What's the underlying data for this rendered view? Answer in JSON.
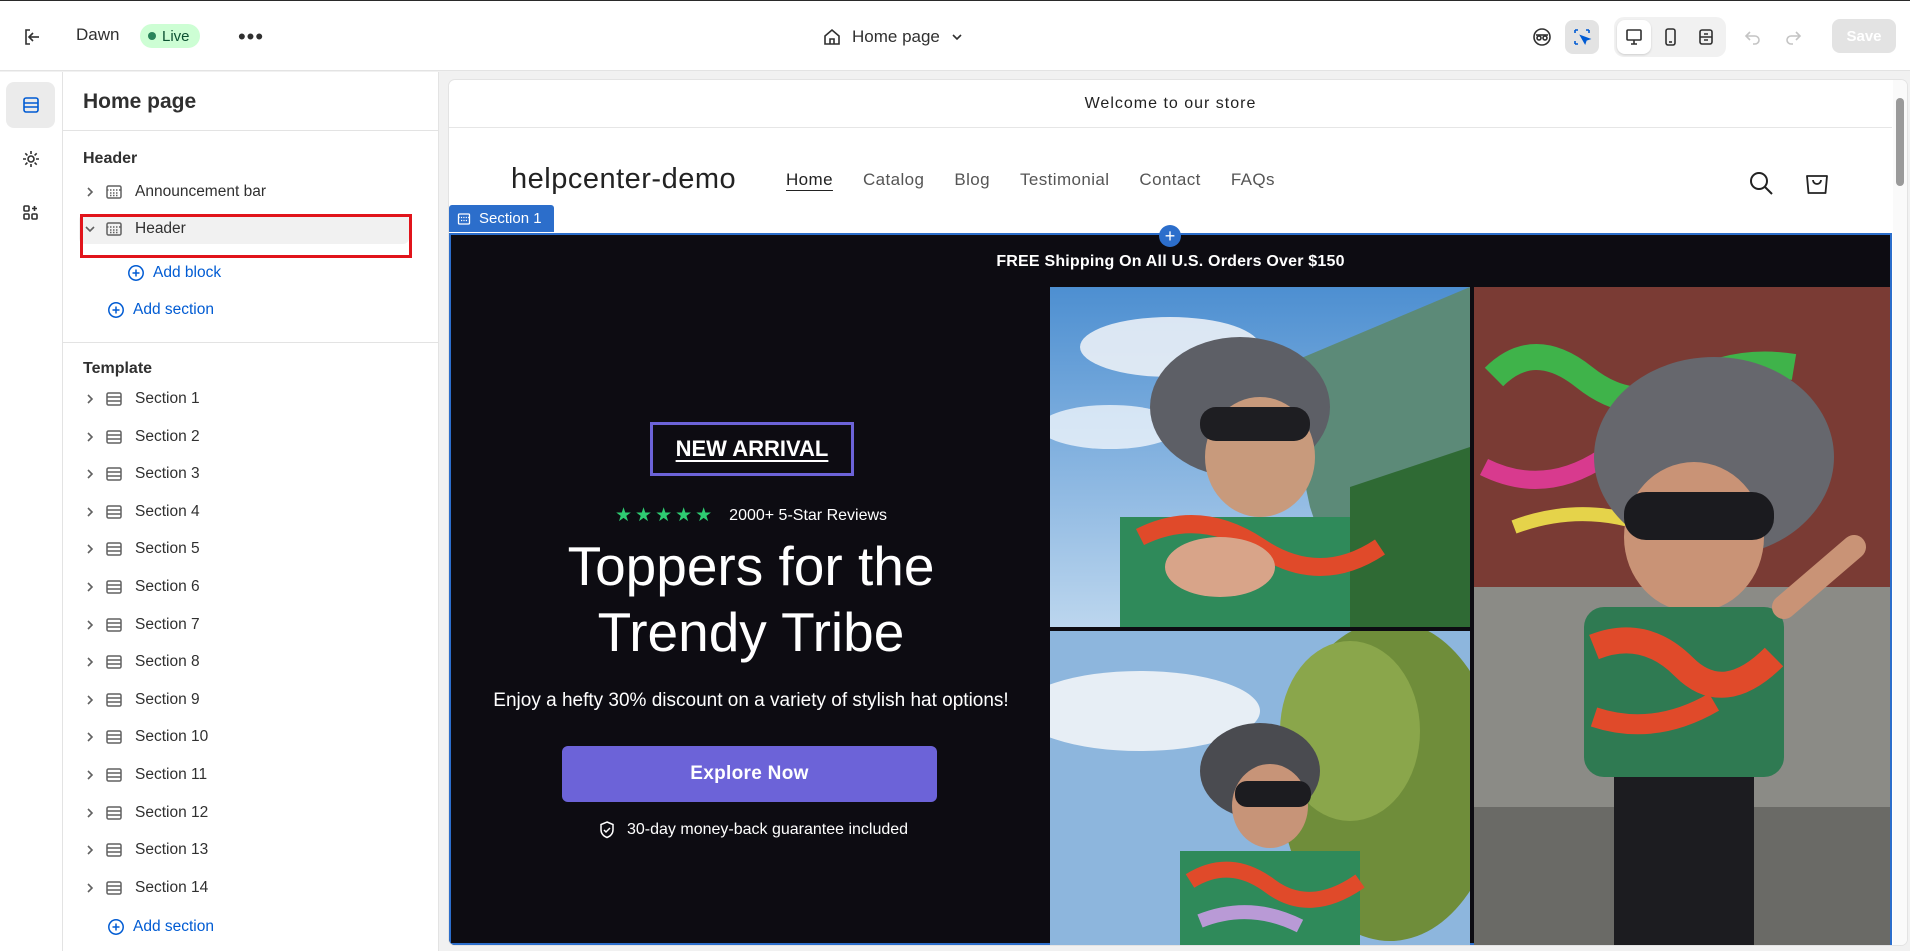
{
  "topbar": {
    "theme_name": "Dawn",
    "live_label": "Live",
    "page_selector": "Home page",
    "save_label": "Save"
  },
  "sidebar": {
    "title": "Home page",
    "header_group": {
      "title": "Header",
      "items": [
        {
          "label": "Announcement bar",
          "expanded": false
        },
        {
          "label": "Header",
          "expanded": true,
          "selected": true
        }
      ],
      "add_block": "Add block",
      "add_section": "Add section"
    },
    "template_group": {
      "title": "Template",
      "items": [
        {
          "label": "Section 1"
        },
        {
          "label": "Section 2"
        },
        {
          "label": "Section 3"
        },
        {
          "label": "Section 4"
        },
        {
          "label": "Section 5"
        },
        {
          "label": "Section 6"
        },
        {
          "label": "Section 7"
        },
        {
          "label": "Section 8"
        },
        {
          "label": "Section 9"
        },
        {
          "label": "Section 10"
        },
        {
          "label": "Section 11"
        },
        {
          "label": "Section 12"
        },
        {
          "label": "Section 13"
        },
        {
          "label": "Section 14"
        }
      ],
      "add_section": "Add section"
    }
  },
  "preview": {
    "announcement": "Welcome to our store",
    "store_name": "helpcenter-demo",
    "nav": [
      "Home",
      "Catalog",
      "Blog",
      "Testimonial",
      "Contact",
      "FAQs"
    ],
    "section_tag": "Section 1",
    "hero": {
      "shipping": "FREE Shipping On All U.S. Orders Over $150",
      "badge": "NEW ARRIVAL",
      "stars": "★★★★★",
      "reviews": "2000+ 5-Star Reviews",
      "headline_line1": "Toppers for the",
      "headline_line2": "Trendy Tribe",
      "subtext": "Enjoy a hefty 30% discount on a variety of stylish hat options!",
      "cta": "Explore Now",
      "guarantee": "30-day money-back guarantee included"
    }
  },
  "colors": {
    "accent_blue": "#2c6ecb",
    "highlight_red": "#e1141b",
    "cta_purple": "#6c63d8",
    "hero_bg": "#0d0c12",
    "star_green": "#2ecc71"
  }
}
